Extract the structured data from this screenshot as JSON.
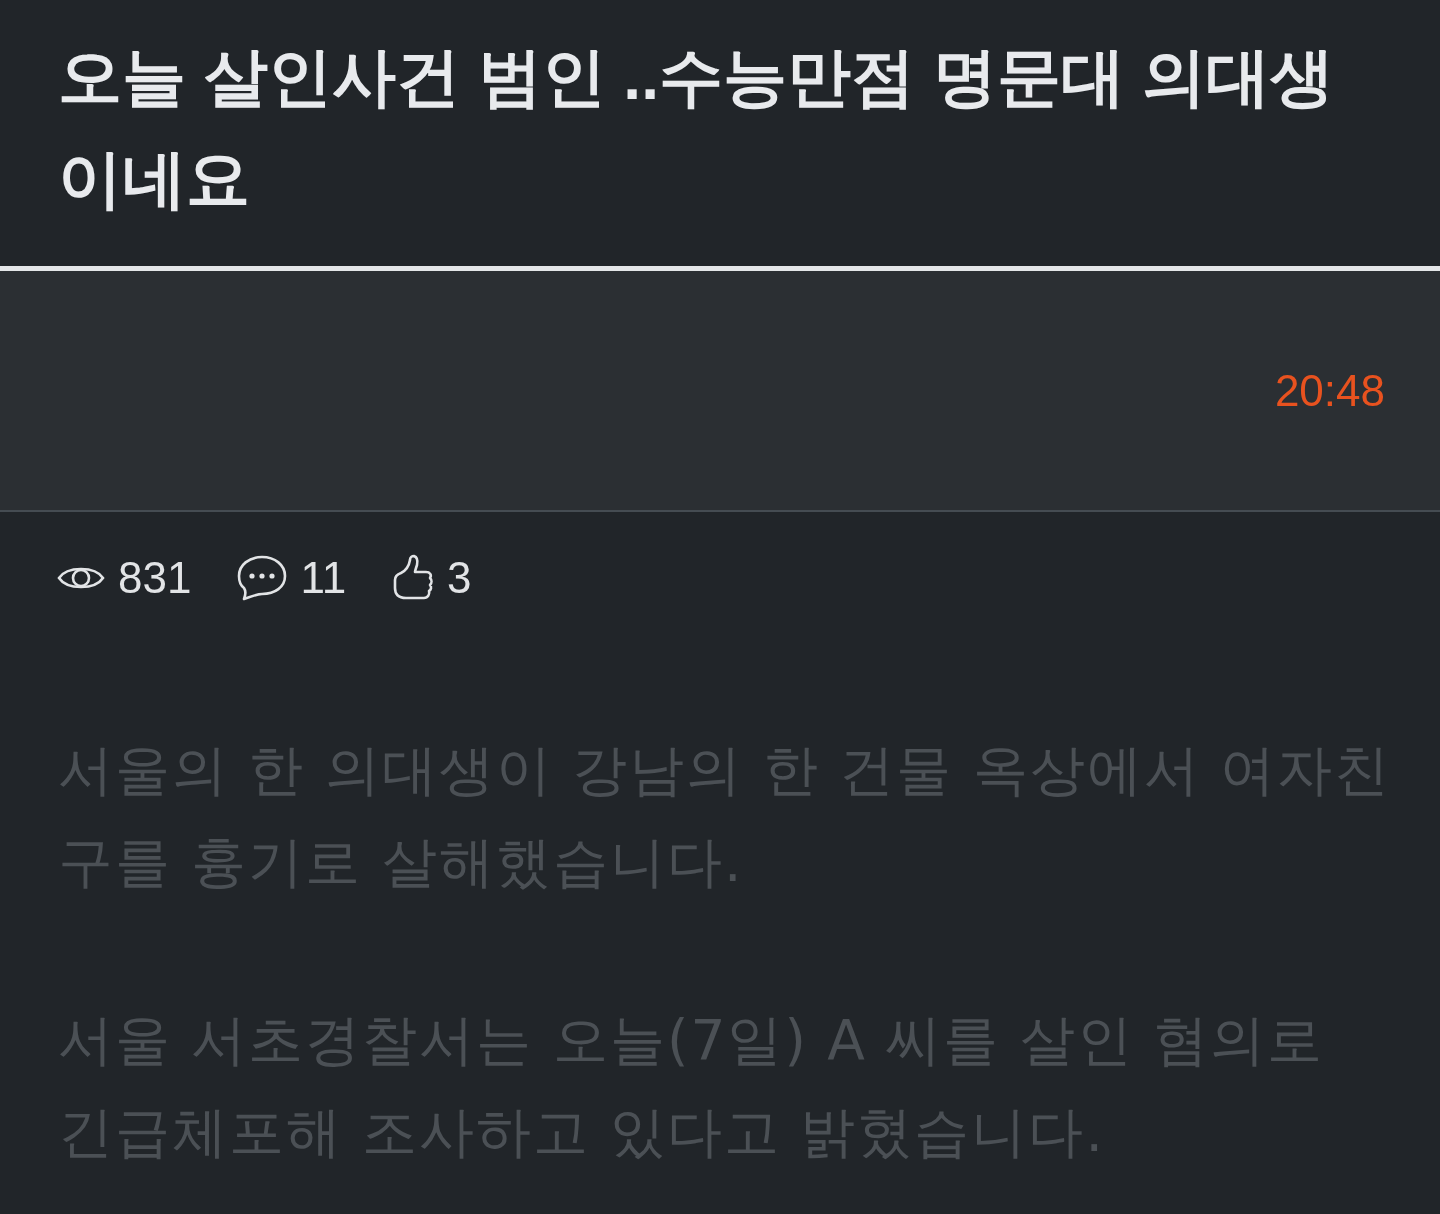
{
  "post": {
    "title": "오늘 살인사건 범인 ..수능만점 명문대 의대생 이네요"
  },
  "meta": {
    "time": "20:48"
  },
  "stats": [
    {
      "kind": "views",
      "count": "831"
    },
    {
      "kind": "comments",
      "count": "11"
    },
    {
      "kind": "likes",
      "count": "3"
    }
  ],
  "body": {
    "paragraphs": [
      "서울의 한 의대생이 강남의 한 건물 옥상에서 여자친구를 흉기로 살해했습니다.",
      "서울 서초경찰서는 오늘(7일) A 씨를 살인 혐의로 긴급체포해 조사하고 있다고 밝혔습니다."
    ]
  }
}
